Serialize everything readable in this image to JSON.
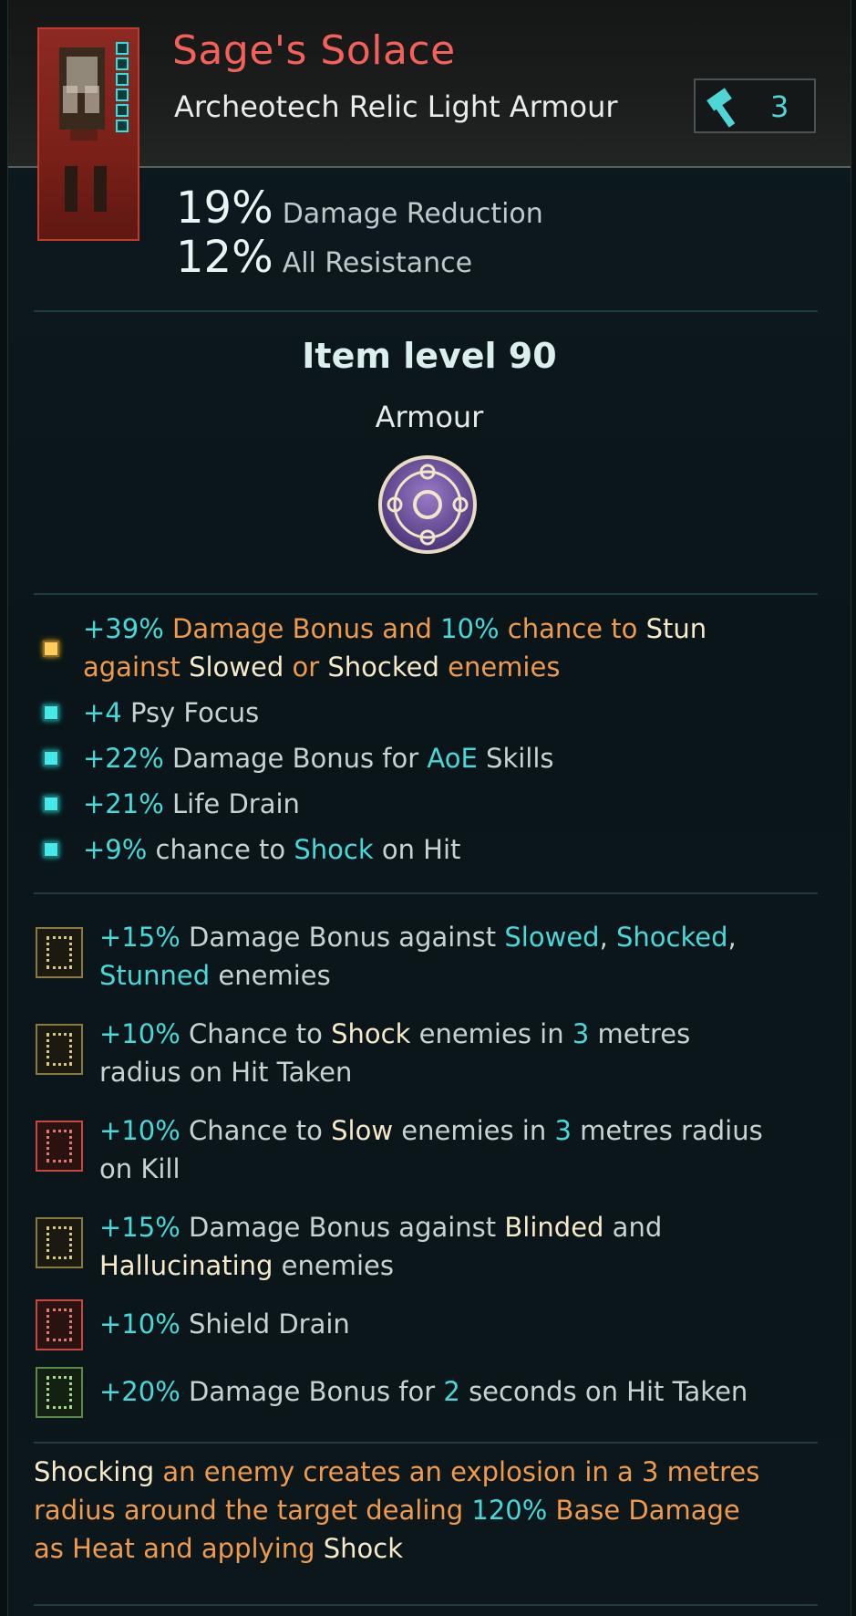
{
  "item": {
    "name": "Sage's Solace",
    "type": "Archeotech Relic Light Armour",
    "mod_count": "3",
    "sockets": 6,
    "colors": {
      "name": "#f4615a",
      "highlight_cyan": "#48d8d8",
      "highlight_yellow": "#f6eac8",
      "orange": "#f09a4c"
    }
  },
  "stats": [
    {
      "value": "19%",
      "label": "Damage Reduction"
    },
    {
      "value": "12%",
      "label": "All Resistance"
    }
  ],
  "item_level": "Item level 90",
  "slot": "Armour",
  "emblem_icon": "psy-emblem-icon",
  "affixes": {
    "a0": {
      "p1": "+39%",
      "p2": " Damage Bonus and ",
      "p3": "10%",
      "p4": " chance to ",
      "p5": "Stun",
      "p6": "against ",
      "p7": "Slowed",
      "p8": " or ",
      "p9": "Shocked",
      "p10": " enemies"
    },
    "a1": {
      "p1": "+4",
      "p2": " Psy Focus"
    },
    "a2": {
      "p1": "+22%",
      "p2": " Damage Bonus for ",
      "p3": "AoE",
      "p4": " Skills"
    },
    "a3": {
      "p1": "+21%",
      "p2": " Life Drain"
    },
    "a4": {
      "p1": "+9%",
      "p2": " chance to ",
      "p3": "Shock",
      "p4": " on Hit"
    }
  },
  "runes": {
    "r0": {
      "p1": "+15%",
      "p2": " Damage Bonus against ",
      "p3": "Slowed",
      "p4": ", ",
      "p5": "Shocked",
      "p6": ",",
      "p7": "Stunned",
      "p8": " enemies"
    },
    "r1": {
      "p1": "+10%",
      "p2": " Chance to ",
      "p3": "Shock",
      "p4": " enemies in ",
      "p5": "3",
      "p6": " metres",
      "p7": "radius on Hit Taken"
    },
    "r2": {
      "p1": "+10%",
      "p2": " Chance to ",
      "p3": "Slow",
      "p4": " enemies in ",
      "p5": "3",
      "p6": " metres radius",
      "p7": "on Kill"
    },
    "r3": {
      "p1": "+15%",
      "p2": " Damage Bonus against ",
      "p3": "Blinded",
      "p4": " and",
      "p5": "Hallucinating",
      "p6": " enemies"
    },
    "r4": {
      "p1": "+10%",
      "p2": " Shield Drain"
    },
    "r5": {
      "p1": "+20%",
      "p2": " Damage Bonus for ",
      "p3": "2",
      "p4": " seconds on Hit Taken"
    }
  },
  "unique_effect": {
    "p1": "Shocking",
    "p2": " an enemy creates an explosion in a 3 metres",
    "p3": "radius around the target dealing ",
    "p4": "120%",
    "p5": " Base Damage",
    "p6": "as Heat and applying ",
    "p7": "Shock"
  }
}
